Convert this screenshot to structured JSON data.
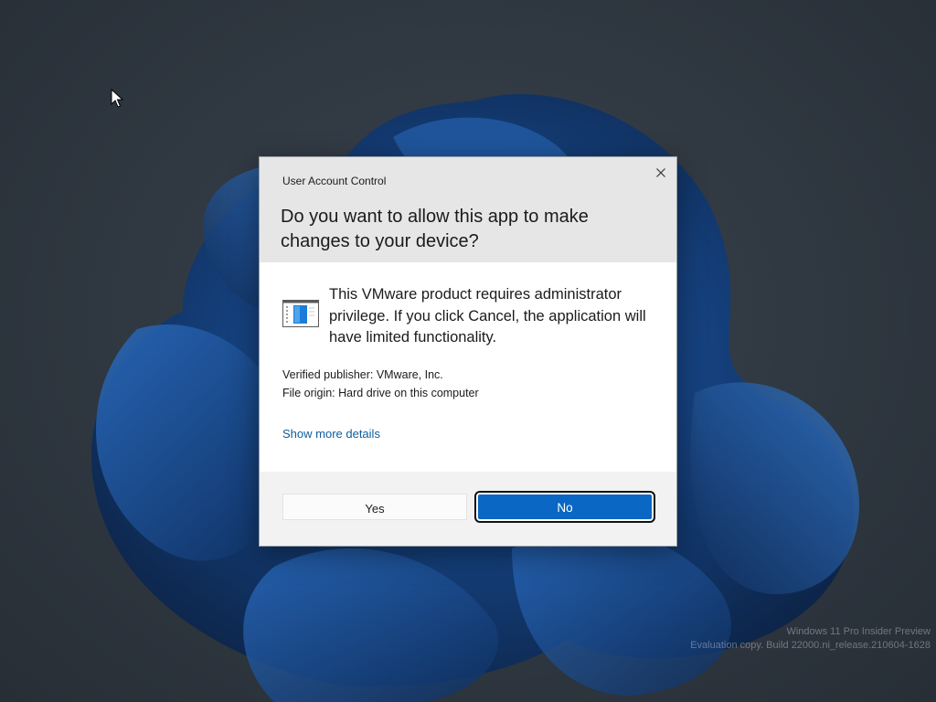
{
  "dialog": {
    "title": "User Account Control",
    "question": "Do you want to allow this app to make changes to your device?",
    "message": "This VMware product requires administrator privilege. If you click Cancel, the application will have limited functionality.",
    "publisher_line": "Verified publisher: VMware, Inc.",
    "origin_line": "File origin: Hard drive on this computer",
    "details_link": "Show more details",
    "yes_label": "Yes",
    "no_label": "No",
    "close_icon": "close-icon",
    "app_icon": "app-window-icon",
    "accent_color": "#0a67c3"
  },
  "desktop": {
    "watermark_line1": "Windows 11 Pro Insider Preview",
    "watermark_line2": "Evaluation copy. Build 22000.ni_release.210604-1628",
    "cursor_icon": "mouse-pointer-icon"
  }
}
